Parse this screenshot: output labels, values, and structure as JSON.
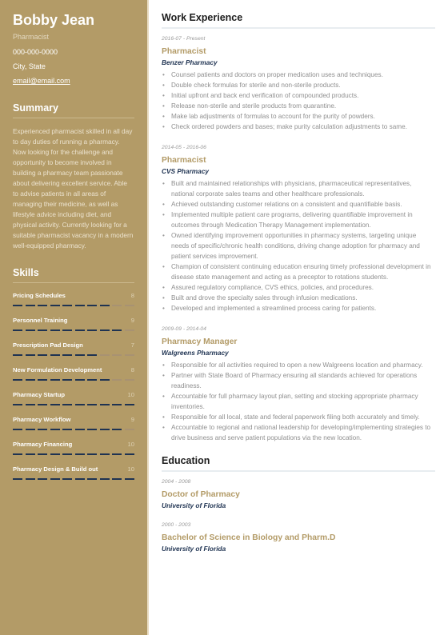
{
  "profile": {
    "name": "Bobby Jean",
    "role": "Pharmacist",
    "phone": "000-000-0000",
    "location": "City, State",
    "email": "email@email.com"
  },
  "summary": {
    "heading": "Summary",
    "text": "Experienced pharmacist skilled in all day to day duties of running a pharmacy. Now looking for the challenge and opportunity to become involved in building a pharmacy team passionate about delivering excellent service. Able to advise patients in all areas of managing their medicine, as well as lifestyle advice including diet, and physical activity. Currently looking for a suitable pharmacist vacancy in a modern well-equipped pharmacy."
  },
  "skills": {
    "heading": "Skills",
    "max": 10,
    "items": [
      {
        "label": "Pricing Schedules",
        "value": 8
      },
      {
        "label": "Personnel Training",
        "value": 9
      },
      {
        "label": "Prescription Pad Design",
        "value": 7
      },
      {
        "label": "New Formulation Development",
        "value": 8
      },
      {
        "label": "Pharmacy Startup",
        "value": 10
      },
      {
        "label": "Pharmacy Workflow",
        "value": 9
      },
      {
        "label": "Pharmacy Financing",
        "value": 10
      },
      {
        "label": "Pharmacy Design & Build out",
        "value": 10
      }
    ]
  },
  "work": {
    "heading": "Work Experience",
    "jobs": [
      {
        "date": "2016-07 - Present",
        "title": "Pharmacist",
        "org": "Benzer Pharmacy",
        "bullets": [
          "Counsel patients and doctors on proper medication uses and techniques.",
          "Double check formulas for sterile and non-sterile products.",
          "Initial upfront and back end verification of compounded products.",
          "Release non-sterile and sterile products from quarantine.",
          "Make lab adjustments of formulas to account for the purity of powders.",
          "Check ordered powders and bases; make purity calculation adjustments to same."
        ]
      },
      {
        "date": "2014-05 - 2016-06",
        "title": "Pharmacist",
        "org": "CVS Pharmacy",
        "bullets": [
          "Built and maintained relationships with physicians, pharmaceutical representatives, national corporate sales teams and other healthcare professionals.",
          "Achieved outstanding customer relations on a consistent and quantifiable basis.",
          "Implemented multiple patient care programs, delivering quantifiable improvement in outcomes through Medication Therapy Management implementation.",
          "Owned identifying improvement opportunities in pharmacy systems, targeting unique needs of specific/chronic health conditions, driving change adoption for pharmacy and patient services improvement.",
          "Champion of consistent continuing education ensuring timely professional development in disease state management and acting as a preceptor to rotations students.",
          "Assured regulatory compliance, CVS ethics, policies, and procedures.",
          "Built and drove the specialty sales through infusion medications.",
          "Developed and implemented a streamlined process caring for patients."
        ]
      },
      {
        "date": "2009-09 - 2014-04",
        "title": "Pharmacy Manager",
        "org": "Walgreens Pharmacy",
        "bullets": [
          "Responsible for all activities required to open a new Walgreens location and pharmacy.",
          "Partner with State Board of Pharmacy ensuring all standards achieved for operations readiness.",
          "Accountable for full pharmacy layout plan, setting and stocking appropriate pharmacy inventories.",
          "Responsible for all local, state and federal paperwork filing both accurately and timely.",
          "Accountable to regional and national leadership for developing/implementing strategies to drive business and serve patient populations via the new location."
        ]
      }
    ]
  },
  "education": {
    "heading": "Education",
    "items": [
      {
        "date": "2004 - 2008",
        "degree": "Doctor of Pharmacy",
        "school": "University of Florida"
      },
      {
        "date": "2000 - 2003",
        "degree": "Bachelor of Science in Biology and Pharm.D",
        "school": "University of Florida"
      }
    ]
  },
  "colors": {
    "sidebar": "#b39b67",
    "accent": "#b39b67",
    "navy": "#1f3352"
  }
}
